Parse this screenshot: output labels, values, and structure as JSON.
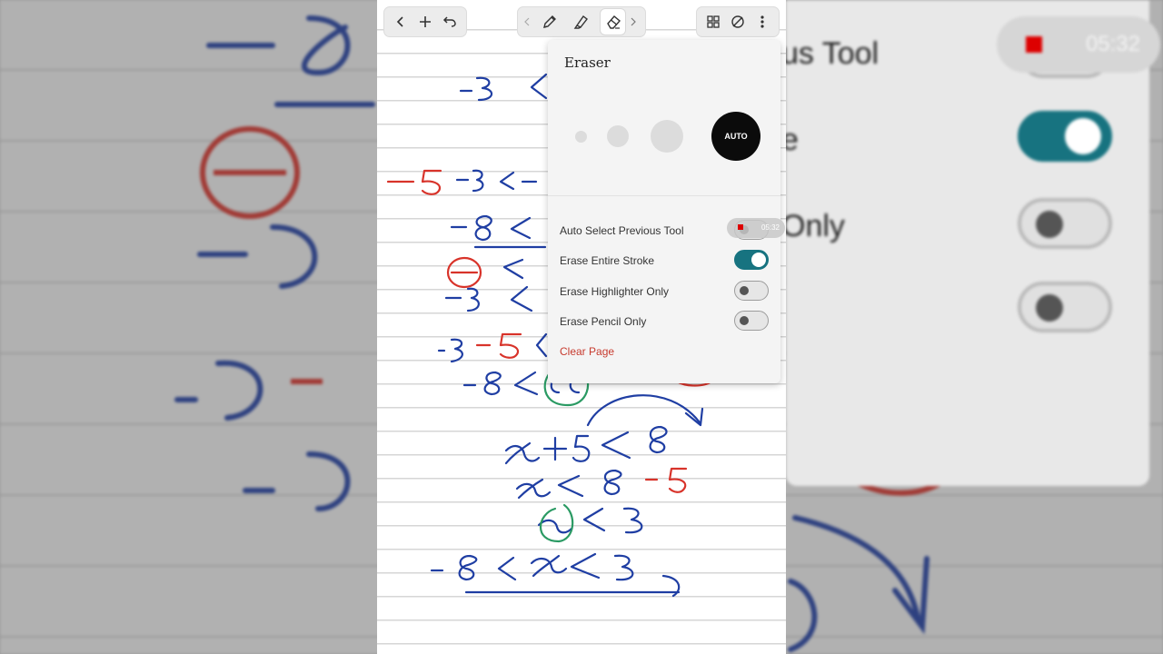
{
  "toolbar": {
    "left": [
      {
        "name": "back-button",
        "icon": "chevron-left-icon",
        "glyph": "‹"
      },
      {
        "name": "add-button",
        "icon": "plus-icon",
        "glyph": "+"
      },
      {
        "name": "undo-button",
        "icon": "undo-icon",
        "glyph": "↶"
      }
    ],
    "tools": [
      {
        "name": "pen-tool-button",
        "icon": "pen-icon"
      },
      {
        "name": "highlighter-tool-button",
        "icon": "highlighter-icon"
      },
      {
        "name": "eraser-tool-button",
        "icon": "eraser-icon",
        "active": true
      }
    ],
    "right": [
      {
        "name": "pages-grid-button",
        "icon": "grid-icon"
      },
      {
        "name": "no-background-button",
        "icon": "circle-slash-icon"
      },
      {
        "name": "more-button",
        "icon": "more-vertical-icon"
      }
    ]
  },
  "eraser_panel": {
    "title": "Eraser",
    "sizes": [
      "small",
      "medium",
      "large"
    ],
    "auto_label": "AUTO",
    "options": [
      {
        "label": "Auto Select Previous Tool",
        "on": false
      },
      {
        "label": "Erase Entire Stroke",
        "on": true
      },
      {
        "label": "Erase Highlighter Only",
        "on": false
      },
      {
        "label": "Erase Pencil Only",
        "on": false
      }
    ],
    "clear_label": "Clear Page"
  },
  "recording": {
    "time": "05:32"
  },
  "background_mirror": {
    "text_1": "us Tool",
    "text_2": "e",
    "text_3": "Only"
  },
  "colors": {
    "ink_blue": "#1f3ea3",
    "ink_red": "#d8332a",
    "ink_green": "#2a9a63",
    "toggle_on": "#177380",
    "clear_red": "#c73a2e"
  }
}
